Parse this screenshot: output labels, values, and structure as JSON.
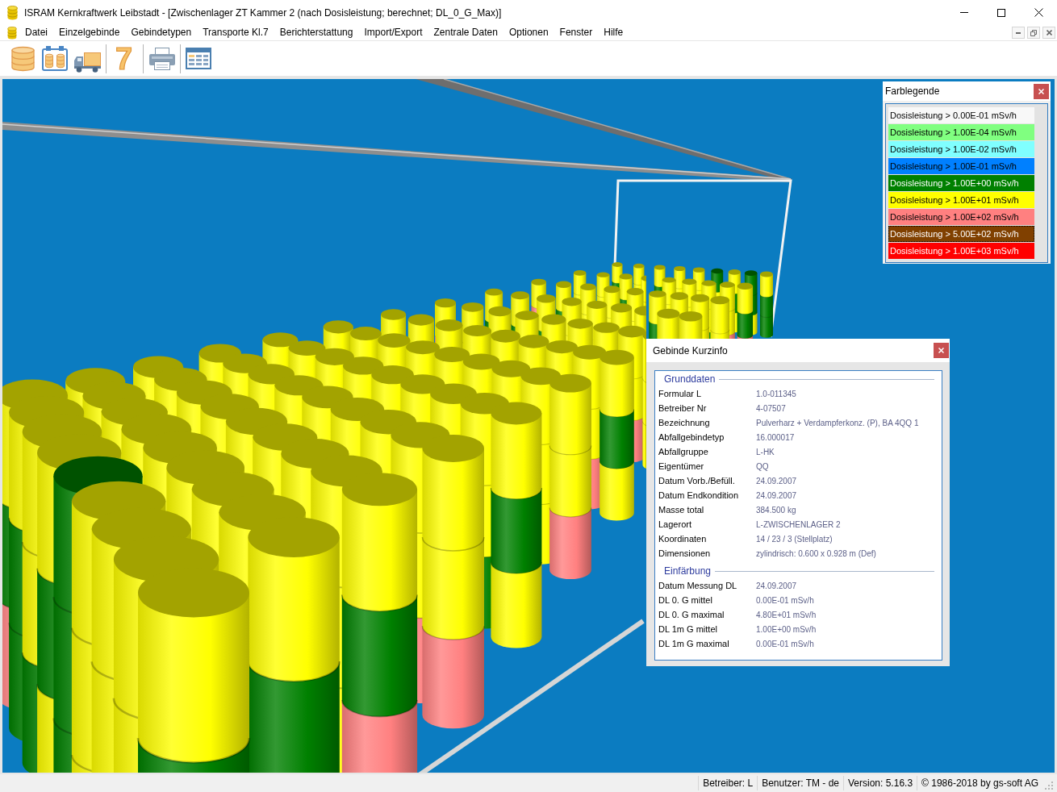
{
  "window": {
    "title": "ISRAM Kernkraftwerk Leibstadt - [Zwischenlager ZT Kammer 2 (nach Dosisleistung; berechnet; DL_0_G_Max)]"
  },
  "menu": [
    "Datei",
    "Einzelgebinde",
    "Gebindetypen",
    "Transporte Kl.7",
    "Berichterstattung",
    "Import/Export",
    "Zentrale Daten",
    "Optionen",
    "Fenster",
    "Hilfe"
  ],
  "toolbar": {
    "transport_class_button": "7"
  },
  "color_legend": {
    "title": "Farblegende",
    "items": [
      {
        "label": "Dosisleistung > 0.00E-01 mSv/h",
        "color": "#f8f8f8",
        "selected": false
      },
      {
        "label": "Dosisleistung > 1.00E-04 mSv/h",
        "color": "#80ff80",
        "selected": false
      },
      {
        "label": "Dosisleistung > 1.00E-02 mSv/h",
        "color": "#80ffff",
        "selected": false
      },
      {
        "label": "Dosisleistung > 1.00E-01 mSv/h",
        "color": "#0080ff",
        "selected": false
      },
      {
        "label": "Dosisleistung > 1.00E+00 mSv/h",
        "color": "#008000",
        "selected": false
      },
      {
        "label": "Dosisleistung > 1.00E+01 mSv/h",
        "color": "#ffff00",
        "selected": false
      },
      {
        "label": "Dosisleistung > 1.00E+02 mSv/h",
        "color": "#ff8080",
        "selected": false
      },
      {
        "label": "Dosisleistung > 5.00E+02 mSv/h",
        "color": "#804000",
        "selected": true
      },
      {
        "label": "Dosisleistung > 1.00E+03 mSv/h",
        "color": "#ff0000",
        "selected": false
      }
    ]
  },
  "info_panel": {
    "title": "Gebinde Kurzinfo",
    "groups": [
      {
        "title": "Grunddaten",
        "fields": [
          {
            "label": "Formular L",
            "value": "1.0-011345"
          },
          {
            "label": "Betreiber Nr",
            "value": "4-07507"
          },
          {
            "label": "Bezeichnung",
            "value": "Pulverharz + Verdampferkonz. (P), BA 4QQ 1"
          },
          {
            "label": "Abfallgebindetyp",
            "value": "16.000017"
          },
          {
            "label": "Abfallgruppe",
            "value": "L-HK"
          },
          {
            "label": "Eigentümer",
            "value": "QQ"
          },
          {
            "label": "Datum Vorb./Befüll.",
            "value": "24.09.2007"
          },
          {
            "label": "Datum Endkondition",
            "value": "24.09.2007"
          },
          {
            "label": "Masse total",
            "value": "384.500 kg"
          },
          {
            "label": "Lagerort",
            "value": "L-ZWISCHENLAGER 2"
          },
          {
            "label": "Koordinaten",
            "value": "14 / 23 / 3 (Stellplatz)"
          },
          {
            "label": "Dimensionen",
            "value": "zylindrisch: 0.600 x 0.928 m (Def)"
          }
        ]
      },
      {
        "title": "Einfärbung",
        "fields": [
          {
            "label": "Datum Messung DL",
            "value": "24.09.2007"
          },
          {
            "label": "DL 0. G mittel",
            "value": "0.00E-01 mSv/h"
          },
          {
            "label": "DL 0. G maximal",
            "value": "4.80E+01 mSv/h"
          },
          {
            "label": "DL 1m G mittel",
            "value": "1.00E+00 mSv/h"
          },
          {
            "label": "DL 1m G maximal",
            "value": "0.00E-01 mSv/h"
          }
        ]
      }
    ]
  },
  "status_bar": [
    "Betreiber: L",
    "Benutzer: TM - de",
    "Version: 5.16.3",
    "© 1986-2018 by gs-soft AG"
  ]
}
